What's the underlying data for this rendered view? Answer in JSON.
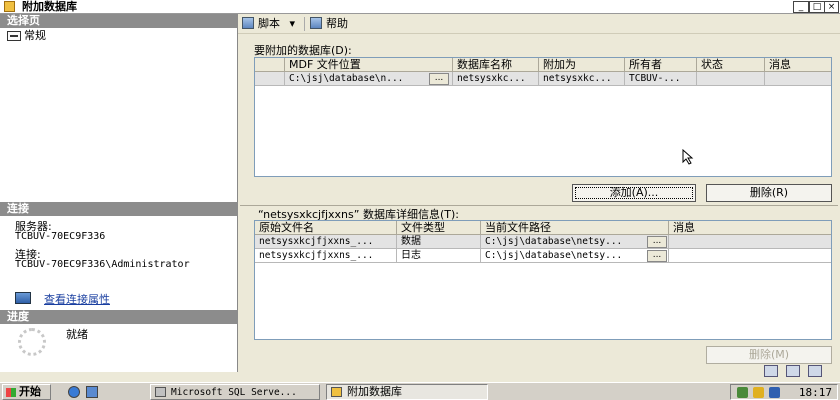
{
  "window": {
    "title": "附加数据库",
    "buttons": {
      "minimize": "_",
      "maximize": "□",
      "close": "×"
    }
  },
  "left": {
    "select_page_header": "选择页",
    "pages": [
      {
        "label": "常规",
        "icon": "page-icon"
      }
    ],
    "connection_header": "连接",
    "server_label": "服务器:",
    "server_value": "TCBUV-70EC9F336",
    "connection_label": "连接:",
    "connection_value": "TCBUV-70EC9F336\\Administrator",
    "view_props_link": "查看连接属性",
    "progress_header": "进度",
    "status": "就绪"
  },
  "toolbar": {
    "script_label": "脚本",
    "script_dropdown": "▾",
    "help_label": "帮助"
  },
  "attach_group": {
    "label": "要附加的数据库(D):",
    "columns": [
      "MDF 文件位置",
      "数据库名称",
      "附加为",
      "所有者",
      "状态",
      "消息"
    ],
    "rows": [
      {
        "mdf": "C:\\jsj\\database\\n...",
        "ellipsis": "...",
        "db_name": "netsysxkc...",
        "attach_as": "netsysxkc...",
        "owner": "TCBUV-...",
        "status": "",
        "message": ""
      }
    ],
    "add_button": "添加(A)...",
    "remove_button": "删除(R)"
  },
  "details_group": {
    "label": "“netsysxkcjfjxxns” 数据库详细信息(T):",
    "columns": [
      "原始文件名",
      "文件类型",
      "当前文件路径",
      "消息"
    ],
    "rows": [
      {
        "original": "netsysxkcjfjxxns_...",
        "type": "数据",
        "path": "C:\\jsj\\database\\netsy...",
        "ellipsis": "...",
        "message": ""
      },
      {
        "original": "netsysxkcjfjxxns_...",
        "type": "日志",
        "path": "C:\\jsj\\database\\netsy...",
        "ellipsis": "...",
        "message": ""
      }
    ],
    "remove_button": "删除(M)"
  },
  "taskbar": {
    "start": "开始",
    "tasks": [
      {
        "label": "Microsoft SQL Serve...",
        "active": false
      },
      {
        "label": "附加数据库",
        "active": true
      }
    ],
    "clock": "18:17"
  }
}
